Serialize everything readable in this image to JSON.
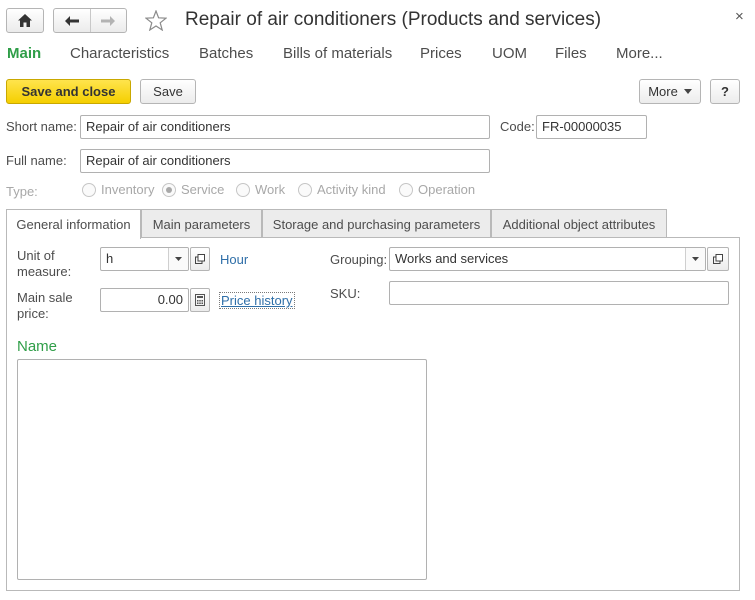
{
  "window": {
    "title": "Repair of air conditioners (Products and services)",
    "close_glyph": "×"
  },
  "icons": {
    "home": "home-icon",
    "back": "arrow-left-icon",
    "forward": "arrow-right-icon",
    "favorite": "star-icon",
    "close": "close-icon",
    "calculator": "calculator-icon",
    "open": "open-window-icon",
    "dropdown": "chevron-down-icon"
  },
  "sections": [
    "Main",
    "Characteristics",
    "Batches",
    "Bills of materials",
    "Prices",
    "UOM",
    "Files",
    "More..."
  ],
  "toolbar": {
    "save_and_close": "Save and close",
    "save": "Save",
    "more": "More",
    "help": "?"
  },
  "form": {
    "short_name_label": "Short name:",
    "short_name_value": "Repair of air conditioners",
    "code_label": "Code:",
    "code_value": "FR-00000035",
    "full_name_label": "Full name:",
    "full_name_value": "Repair of air conditioners",
    "type_label": "Type:",
    "type_options": [
      "Inventory",
      "Service",
      "Work",
      "Activity kind",
      "Operation"
    ],
    "type_selected": "Service"
  },
  "tabs": [
    "General information",
    "Main parameters",
    "Storage and purchasing parameters",
    "Additional object attributes"
  ],
  "general": {
    "uom_label_1": "Unit of",
    "uom_label_2": "measure:",
    "uom_value": "h",
    "uom_description": "Hour",
    "price_label_1": "Main sale",
    "price_label_2": "price:",
    "price_value": "0.00",
    "price_history_link": "Price history",
    "grouping_label": "Grouping:",
    "grouping_value": "Works and services",
    "sku_label": "SKU:",
    "sku_value": "",
    "name_group_title": "Name"
  },
  "colors": {
    "accent_green": "#2f9e48",
    "primary_button": "#f5cf00",
    "link": "#2f6fa8"
  }
}
